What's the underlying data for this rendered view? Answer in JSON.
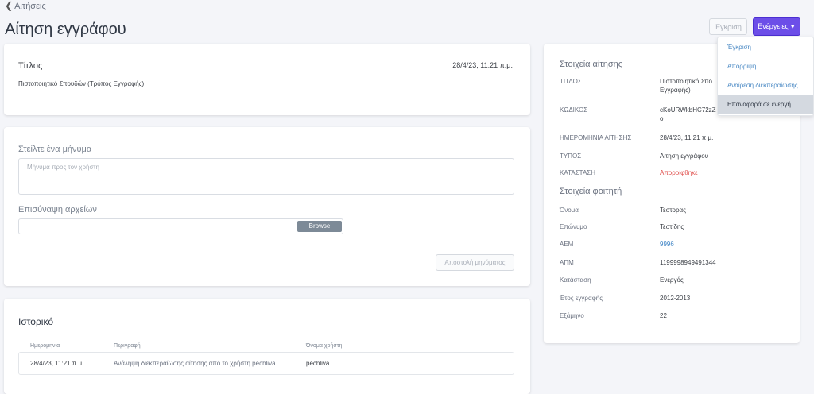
{
  "header": {
    "back_label": "Αιτήσεις",
    "title": "Αίτηση εγγράφου",
    "approve_label": "Έγκριση",
    "actions_label": "Ενέργειες"
  },
  "actions_menu": {
    "items": [
      "Έγκριση",
      "Απόρριψη",
      "Αναίρεση διεκπεραίωσης",
      "Επαναφορά σε ενεργή"
    ],
    "highlighted": "Επαναφορά σε ενεργή"
  },
  "title_card": {
    "label": "Τίτλος",
    "date": "28/4/23, 11:21 π.μ.",
    "value": "Πιστοποιητικό Σπουδών (Τρόπος Εγγραφής)"
  },
  "message_card": {
    "message_label": "Στείλτε ένα μήνυμα",
    "message_placeholder": "Μήνυμα προς τον χρήστη",
    "attach_label": "Επισύναψη αρχείων",
    "browse_label": "Browse",
    "send_label": "Αποστολή μηνύματος"
  },
  "history_card": {
    "title": "Ιστορικό",
    "columns": [
      "Ημερομηνία",
      "Περιγραφή",
      "Όνομα χρήστη"
    ],
    "rows": [
      {
        "date": "28/4/23, 11:21 π.μ.",
        "description": "Ανάληψη διεκπεραίωσης αίτησης από το χρήστη pechliva",
        "user": "pechliva"
      }
    ]
  },
  "request_details": {
    "heading": "Στοιχεία αίτησης",
    "title_label": "ΤΙΤΛΟΣ",
    "title_value_line1": "Πιστοποιητικό Σπο",
    "title_value_line2": "Εγγραφής)",
    "code_label": "ΚΩΔΙΚΟΣ",
    "code_value_line1": "cKoURWkbHC72zZ",
    "code_value_line2": "o",
    "date_label": "ΗΜΕΡΟΜΗΝΙΑ ΑΙΤΗΣΗΣ",
    "date_value": "28/4/23, 11:21 π.μ.",
    "type_label": "ΤΥΠΟΣ",
    "type_value": "Αίτηση εγγράφου",
    "status_label": "ΚΑΤΑΣΤΑΣΗ",
    "status_value": "Απορρίφθηκε",
    "status_color": "#e0524f"
  },
  "student_details": {
    "heading": "Στοιχεία φοιτητή",
    "fields": [
      {
        "label": "Όνομα",
        "value": "Τεστορας"
      },
      {
        "label": "Επώνυμο",
        "value": "Τεστίδης"
      },
      {
        "label": "ΑΕΜ",
        "value": "9996"
      },
      {
        "label": "ΑΠΜ",
        "value": "1199998949491344"
      },
      {
        "label": "Κατάσταση",
        "value": "Ενεργός"
      },
      {
        "label": "Έτος εγγραφής",
        "value": "2012-2013"
      },
      {
        "label": "Εξάμηνο",
        "value": "22"
      }
    ]
  },
  "colors": {
    "primary": "#6c4ee8",
    "link": "#3b82c4",
    "danger": "#e0524f"
  }
}
